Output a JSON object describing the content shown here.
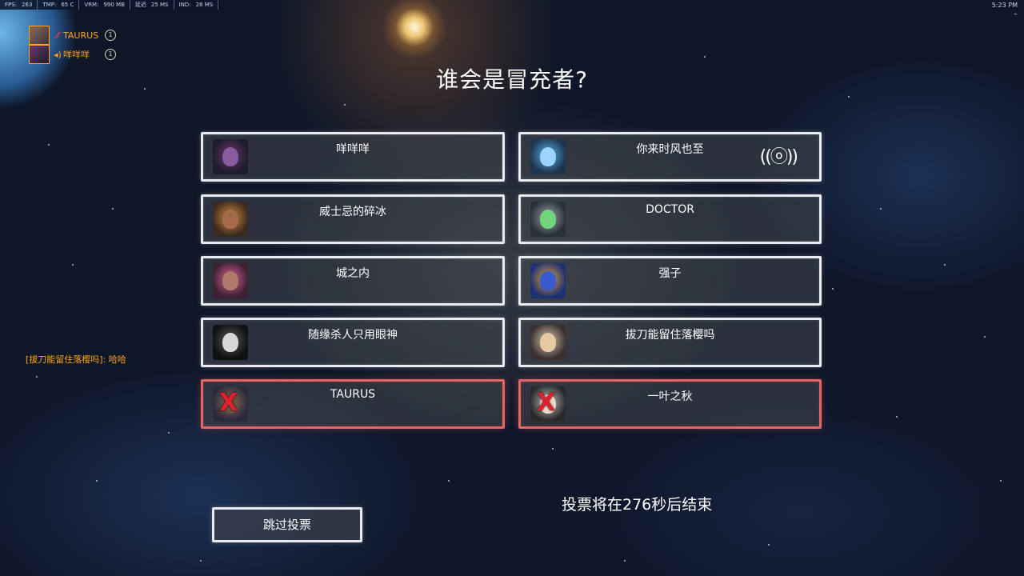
{
  "stats": [
    {
      "label": "FPS:",
      "value": "263"
    },
    {
      "label": "TMP:",
      "value": "65 C"
    },
    {
      "label": "VRM:",
      "value": "990 MB"
    },
    {
      "label": "延迟",
      "value": "25 MS"
    },
    {
      "label": "IND:",
      "value": "28 MS"
    }
  ],
  "clock": "5:23 PM",
  "party": [
    {
      "name": "TAURUS",
      "icon": "dead-slash-icon",
      "status": "1"
    },
    {
      "name": "咩咩咩",
      "icon": "speaking-icon",
      "status": "1"
    }
  ],
  "chat": {
    "text": "[拔刀能留住落樱吗]: 哈哈"
  },
  "title": "谁会是冒充者?",
  "players": [
    {
      "name": "咩咩咩",
      "status": "alive",
      "hero_colors": [
        "#6a3a6a",
        "#1d1a2e",
        "#8a5aa0"
      ]
    },
    {
      "name": "你来时风也至",
      "status": "alive",
      "speaking": true,
      "hero_colors": [
        "#5ab0e8",
        "#1e3550",
        "#9ad4ff"
      ]
    },
    {
      "name": "威士忌的碎冰",
      "status": "alive",
      "hero_colors": [
        "#d08a3a",
        "#3a2a20",
        "#a46a4a"
      ]
    },
    {
      "name": "DOCTOR",
      "status": "alive",
      "hero_colors": [
        "#9aa0a8",
        "#2a3038",
        "#6fd47a"
      ]
    },
    {
      "name": "城之内",
      "status": "alive",
      "hero_colors": [
        "#e060a0",
        "#3a2030",
        "#b07a6a"
      ]
    },
    {
      "name": "强子",
      "status": "alive",
      "hero_colors": [
        "#e0a040",
        "#1e3070",
        "#3a5ad0"
      ]
    },
    {
      "name": "随缘杀人只用眼神",
      "status": "alive",
      "hero_colors": [
        "#5a5a5a",
        "#101010",
        "#d8d8d8"
      ]
    },
    {
      "name": "拔刀能留住落樱吗",
      "status": "alive",
      "hero_colors": [
        "#d8c8b0",
        "#3a3030",
        "#e8c8a0"
      ]
    },
    {
      "name": "TAURUS",
      "status": "dead",
      "hero_colors": [
        "#8a6a5a",
        "#2a2a3a",
        "#6a5040"
      ]
    },
    {
      "name": "一叶之秋",
      "status": "dead",
      "hero_colors": [
        "#c0c0c0",
        "#2a2a2a",
        "#e8d8c8"
      ]
    }
  ],
  "skip_label": "跳过投票",
  "timer_text": "投票将在276秒后结束",
  "speaker_glyph": "((ⓞ))",
  "dead_mark": "X"
}
